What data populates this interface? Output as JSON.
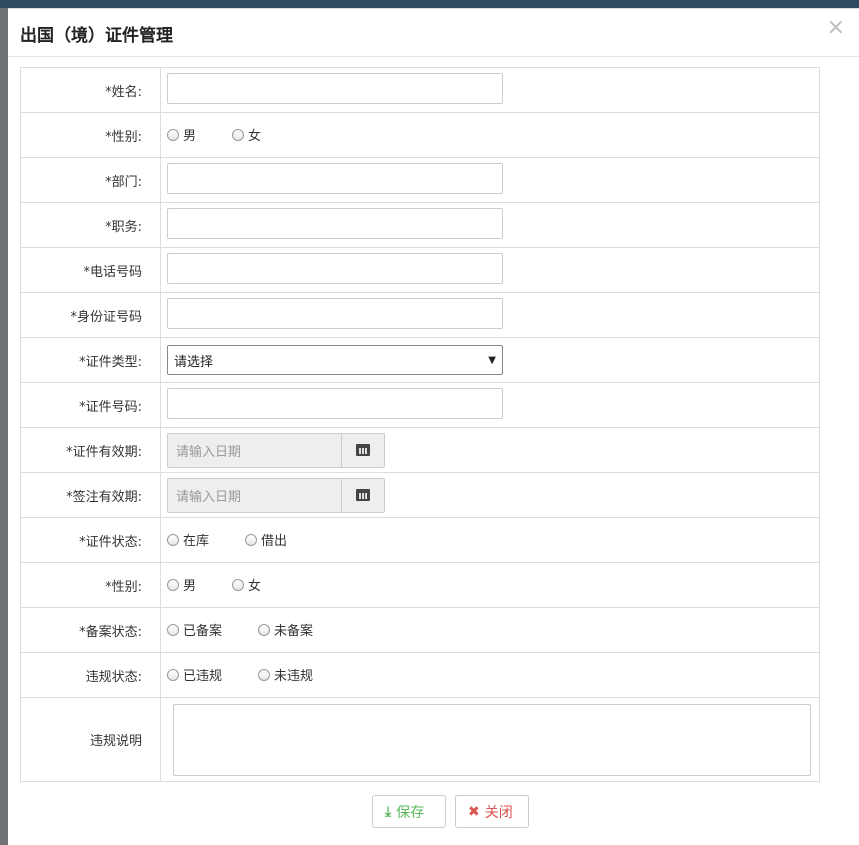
{
  "dialog": {
    "title": "出国（境）证件管理",
    "close_glyph": "×"
  },
  "form": {
    "name_label": "*姓名:",
    "gender_label": "*性别:",
    "gender_options": [
      "男",
      "女"
    ],
    "dept_label": "*部门:",
    "position_label": "*职务:",
    "phone_label": "*电话号码",
    "idcard_label": "*身份证号码",
    "cert_type_label": "*证件类型:",
    "cert_type_value": "请选择",
    "cert_no_label": "*证件号码:",
    "cert_valid_label": "*证件有效期:",
    "cert_valid_placeholder": "请输入日期",
    "visa_valid_label": "*签注有效期:",
    "visa_valid_placeholder": "请输入日期",
    "cert_status_label": "*证件状态:",
    "cert_status_options": [
      "在库",
      "借出"
    ],
    "gender2_label": "*性别:",
    "gender2_options": [
      "男",
      "女"
    ],
    "filing_label": "*备案状态:",
    "filing_options": [
      "已备案",
      "未备案"
    ],
    "violation_label": "违规状态:",
    "violation_options": [
      "已违规",
      "未违规"
    ],
    "violation_desc_label": "违规说明"
  },
  "footer": {
    "save_label": "保存",
    "close_label": "关闭",
    "save_color": "#5cb85c",
    "close_color": "#d9534f"
  },
  "icons": {
    "calendar": "calendar-icon",
    "save": "download-icon",
    "close": "x-icon"
  }
}
